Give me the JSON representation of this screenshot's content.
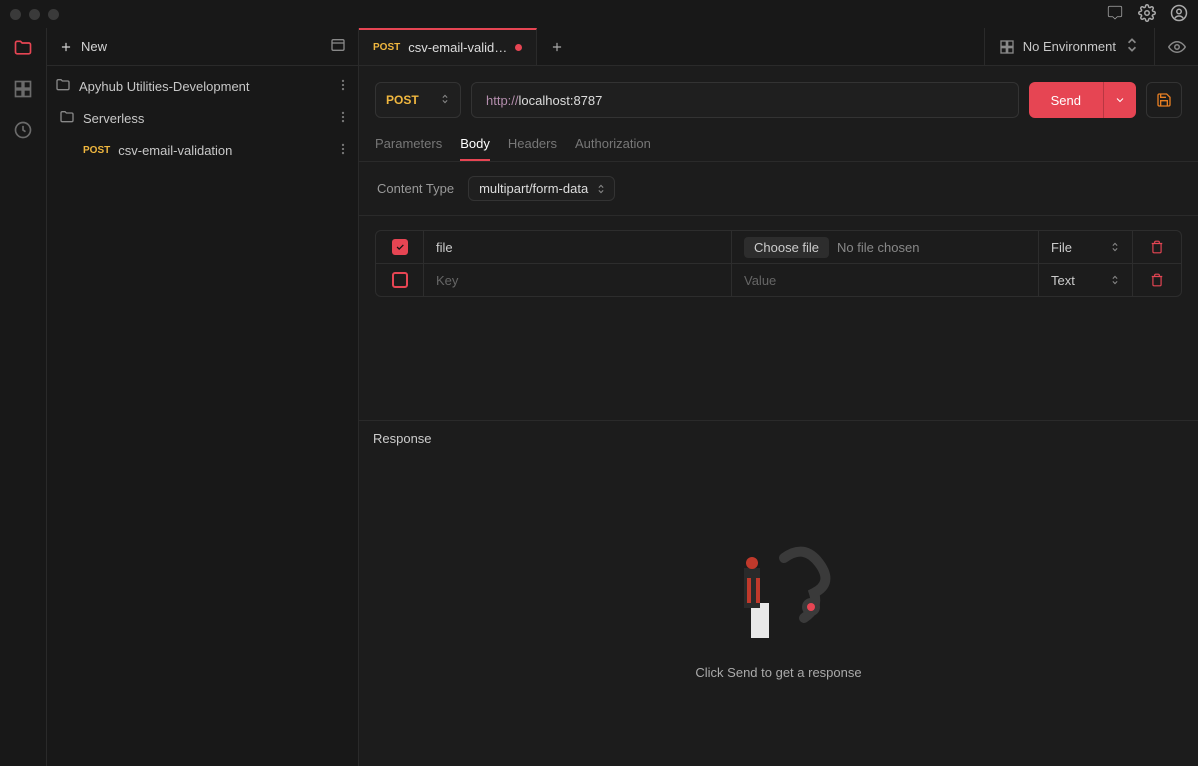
{
  "sidebar": {
    "newLabel": "New",
    "items": [
      {
        "label": "Apyhub Utilities-Development"
      },
      {
        "label": "Serverless"
      },
      {
        "method": "POST",
        "label": "csv-email-validation"
      }
    ]
  },
  "topIcons": {
    "chat": "chat-icon",
    "settings": "gear-icon",
    "account": "user-icon"
  },
  "tab": {
    "method": "POST",
    "title": "csv-email-valid…"
  },
  "env": {
    "label": "No Environment"
  },
  "request": {
    "method": "POST",
    "url_scheme": "http://",
    "url_rest": "localhost:8787",
    "sendLabel": "Send"
  },
  "sectionTabs": [
    "Parameters",
    "Body",
    "Headers",
    "Authorization"
  ],
  "activeSectionTab": "Body",
  "contentType": {
    "label": "Content Type",
    "value": "multipart/form-data"
  },
  "formRows": [
    {
      "enabled": true,
      "key": "file",
      "value": {
        "fileButton": "Choose file",
        "fileStatus": "No file chosen"
      },
      "type": "File"
    },
    {
      "enabled": false,
      "keyPlaceholder": "Key",
      "valuePlaceholder": "Value",
      "type": "Text"
    }
  ],
  "response": {
    "headerLabel": "Response",
    "emptyMessage": "Click Send to get a response"
  }
}
